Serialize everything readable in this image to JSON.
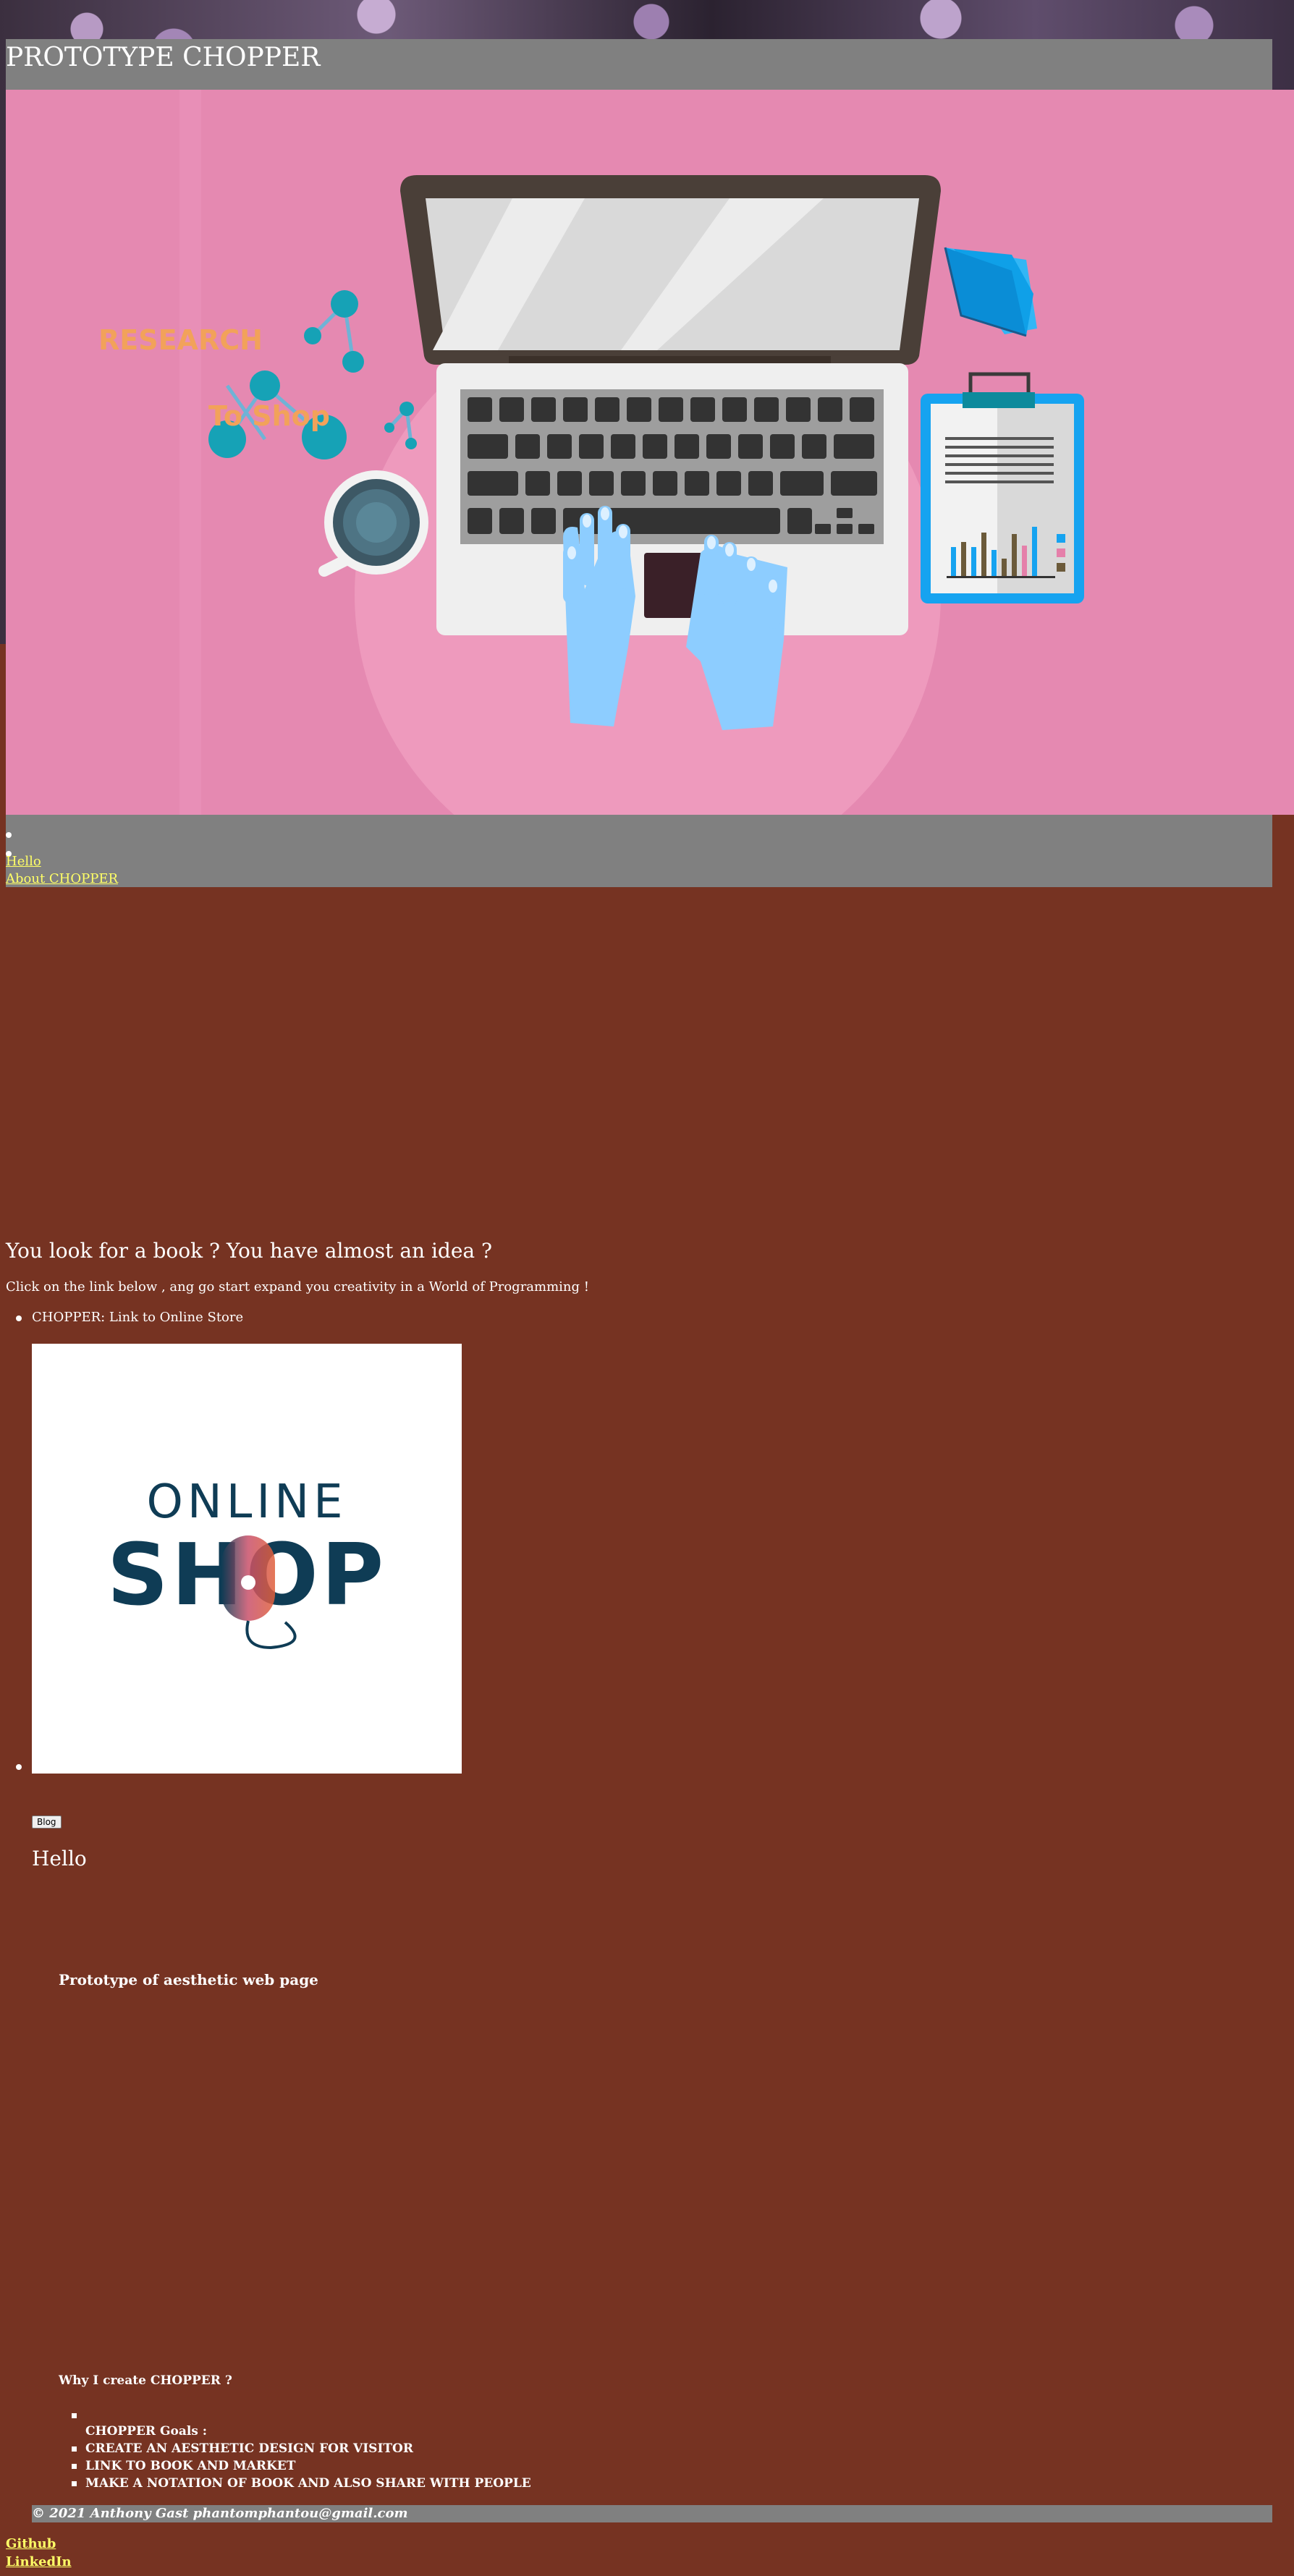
{
  "header": {
    "title": "PROTOTYPE CHOPPER"
  },
  "hero": {
    "word1": "RESEARCH",
    "word2": "To  Shop"
  },
  "nav": {
    "links": [
      "Hello",
      "About CHOPPER"
    ]
  },
  "main": {
    "question": "You look for a book ? You have almost an idea ?",
    "intro": "Click on the link below , ang go start expand you creativity in a World of Programming !",
    "store_link": "CHOPPER: Link to Online Store",
    "shop_logo_top": "ONLINE",
    "shop_logo_bottom": "SHOP",
    "blog_button": "Blog",
    "hello_heading": "Hello",
    "prototype_heading": "Prototype of aesthetic web page",
    "why_heading": "Why I create CHOPPER ?",
    "goals_label": "CHOPPER Goals :",
    "goals": [
      "CREATE AN AESTHETIC DESIGN FOR VISITOR",
      "LINK TO BOOK AND MARKET",
      "MAKE A NOTATION OF BOOK AND ALSO SHARE WITH PEOPLE"
    ]
  },
  "footer": {
    "copyright": "© 2021 Anthony Gast phantomphantou@gmail.com",
    "links": [
      "Github",
      "LinkedIn"
    ]
  },
  "colors": {
    "page_bg": "#763322",
    "bar_gray": "#808080",
    "hero_pink": "#e589b1",
    "link_yellow": "#ffff66"
  }
}
